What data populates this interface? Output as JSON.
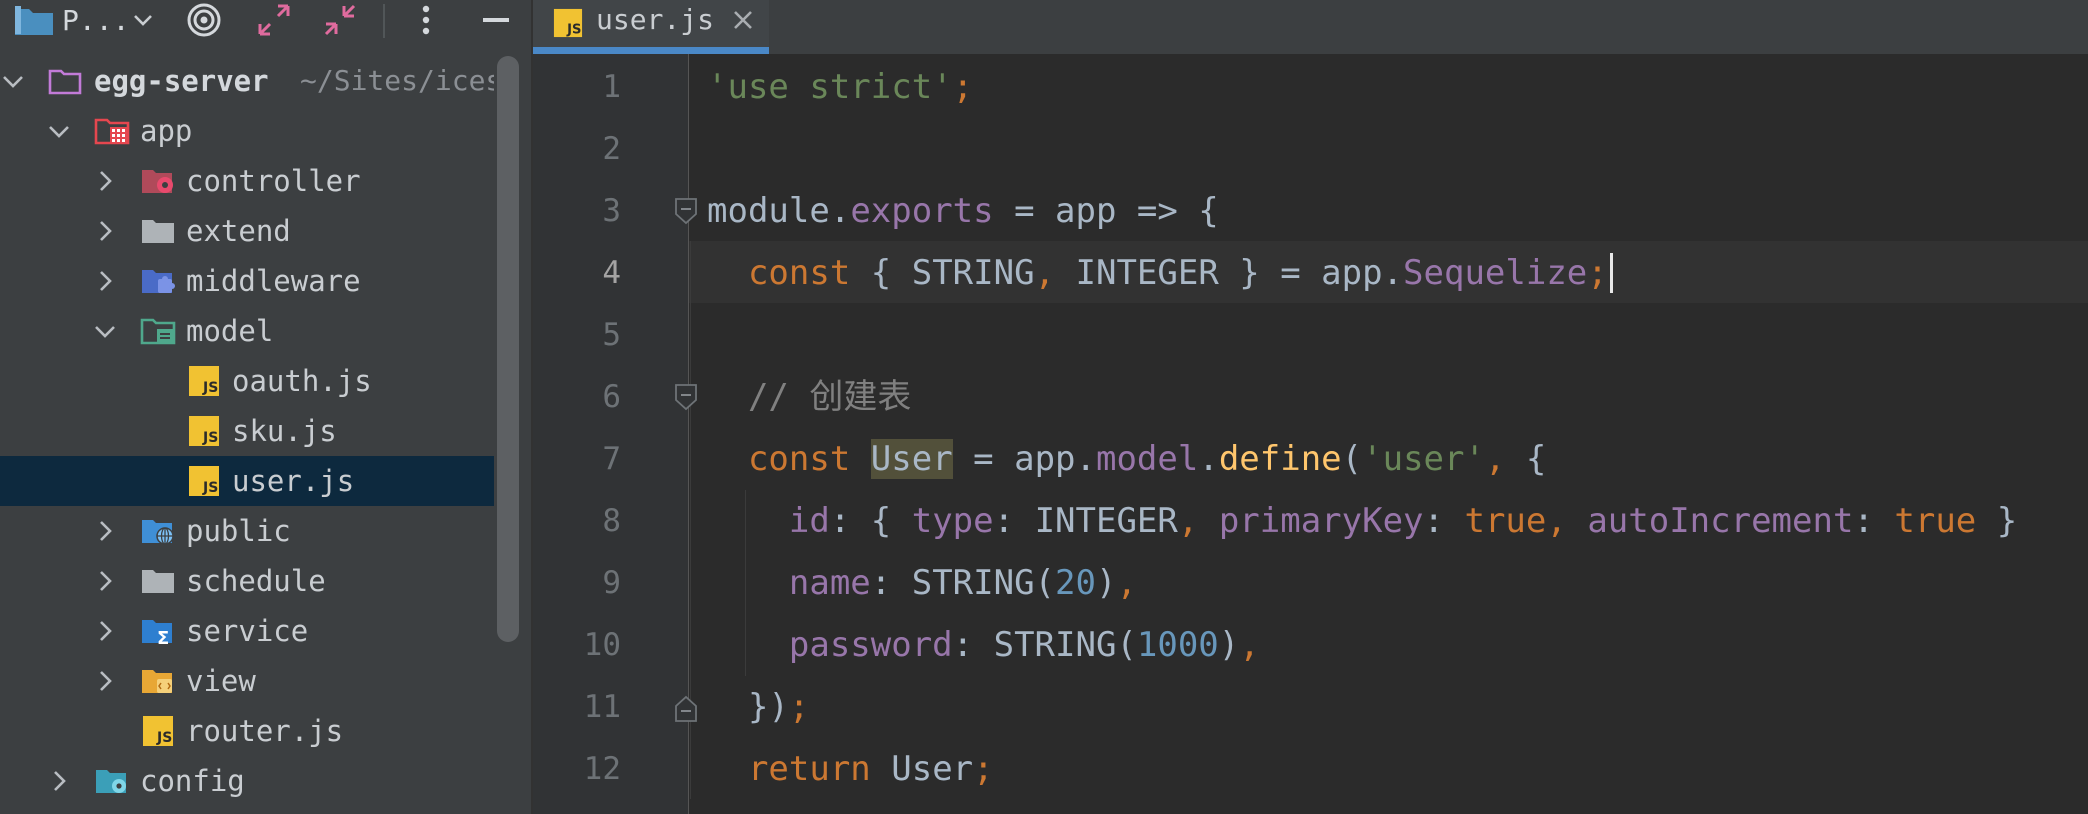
{
  "toolbar": {
    "project_label": "P...",
    "icons": [
      "project-folder-icon",
      "chevron-down-icon",
      "target-icon",
      "expand-icon",
      "collapse-icon",
      "more-vertical-icon",
      "minimize-icon"
    ]
  },
  "tree": {
    "root": {
      "label": "egg-server",
      "hint": "~/Sites/ices"
    },
    "items": [
      {
        "label": "app",
        "icon": "module-folder-icon"
      },
      {
        "label": "controller",
        "icon": "controller-folder-icon"
      },
      {
        "label": "extend",
        "icon": "folder-icon"
      },
      {
        "label": "middleware",
        "icon": "middleware-folder-icon"
      },
      {
        "label": "model",
        "icon": "model-folder-icon"
      },
      {
        "label": "oauth.js",
        "icon": "js-file-icon"
      },
      {
        "label": "sku.js",
        "icon": "js-file-icon"
      },
      {
        "label": "user.js",
        "icon": "js-file-icon",
        "selected": true
      },
      {
        "label": "public",
        "icon": "public-folder-icon"
      },
      {
        "label": "schedule",
        "icon": "folder-icon"
      },
      {
        "label": "service",
        "icon": "service-folder-icon"
      },
      {
        "label": "view",
        "icon": "view-folder-icon"
      },
      {
        "label": "router.js",
        "icon": "js-file-icon"
      },
      {
        "label": "config",
        "icon": "config-folder-icon"
      }
    ]
  },
  "tabs": [
    {
      "label": "user.js",
      "active": true
    }
  ],
  "editor": {
    "line_numbers": [
      "1",
      "2",
      "3",
      "4",
      "5",
      "6",
      "7",
      "8",
      "9",
      "10",
      "11",
      "12"
    ],
    "current_line": "4",
    "lines": [
      [
        {
          "t": "'use strict'",
          "c": "str"
        },
        {
          "t": ";",
          "c": "kw"
        }
      ],
      [],
      [
        {
          "t": "module",
          "c": "pl"
        },
        {
          "t": ".",
          "c": "pl"
        },
        {
          "t": "exports",
          "c": "prop"
        },
        {
          "t": " = app => {",
          "c": "pl"
        }
      ],
      [
        {
          "t": "  "
        },
        {
          "t": "const",
          "c": "kw"
        },
        {
          "t": " { STRING",
          "c": "pl"
        },
        {
          "t": ",",
          "c": "kw"
        },
        {
          "t": " INTEGER } = app.",
          "c": "pl"
        },
        {
          "t": "Sequelize",
          "c": "prop"
        },
        {
          "t": ";",
          "c": "kw"
        }
      ],
      [],
      [
        {
          "t": "  "
        },
        {
          "t": "// 创建表",
          "c": "cmt"
        }
      ],
      [
        {
          "t": "  "
        },
        {
          "t": "const",
          "c": "kw"
        },
        {
          "t": " "
        },
        {
          "t": "User",
          "c": "hl"
        },
        {
          "t": " = app.",
          "c": "pl"
        },
        {
          "t": "model",
          "c": "prop"
        },
        {
          "t": ".",
          "c": "pl"
        },
        {
          "t": "define",
          "c": "fn"
        },
        {
          "t": "(",
          "c": "pl"
        },
        {
          "t": "'user'",
          "c": "str"
        },
        {
          "t": ",",
          "c": "kw"
        },
        {
          "t": " {",
          "c": "pl"
        }
      ],
      [
        {
          "t": "    "
        },
        {
          "t": "id",
          "c": "prop"
        },
        {
          "t": ": { ",
          "c": "pl"
        },
        {
          "t": "type",
          "c": "prop"
        },
        {
          "t": ": INTEGER",
          "c": "pl"
        },
        {
          "t": ", ",
          "c": "kw"
        },
        {
          "t": "primaryKey",
          "c": "prop"
        },
        {
          "t": ": ",
          "c": "pl"
        },
        {
          "t": "true",
          "c": "kw"
        },
        {
          "t": ", ",
          "c": "kw"
        },
        {
          "t": "autoIncrement",
          "c": "prop"
        },
        {
          "t": ": ",
          "c": "pl"
        },
        {
          "t": "true",
          "c": "kw"
        },
        {
          "t": " }",
          "c": "pl"
        }
      ],
      [
        {
          "t": "    "
        },
        {
          "t": "name",
          "c": "prop"
        },
        {
          "t": ": STRING(",
          "c": "pl"
        },
        {
          "t": "20",
          "c": "num"
        },
        {
          "t": ")",
          "c": "pl"
        },
        {
          "t": ",",
          "c": "kw"
        }
      ],
      [
        {
          "t": "    "
        },
        {
          "t": "password",
          "c": "prop"
        },
        {
          "t": ": STRING(",
          "c": "pl"
        },
        {
          "t": "1000",
          "c": "num"
        },
        {
          "t": ")",
          "c": "pl"
        },
        {
          "t": ",",
          "c": "kw"
        }
      ],
      [
        {
          "t": "  "
        },
        {
          "t": "})",
          "c": "pl"
        },
        {
          "t": ";",
          "c": "kw"
        }
      ],
      [
        {
          "t": "  "
        },
        {
          "t": "return",
          "c": "kw"
        },
        {
          "t": " User",
          "c": "pl"
        },
        {
          "t": ";",
          "c": "kw"
        }
      ]
    ]
  },
  "colors": {
    "keyword": "#cc7832",
    "string": "#6a8759",
    "property": "#9876aa",
    "function": "#ffc66d",
    "number": "#6897bb",
    "comment": "#808080",
    "plain": "#a9b7c6",
    "selection": "#0d293e",
    "accent": "#4a88c7"
  }
}
